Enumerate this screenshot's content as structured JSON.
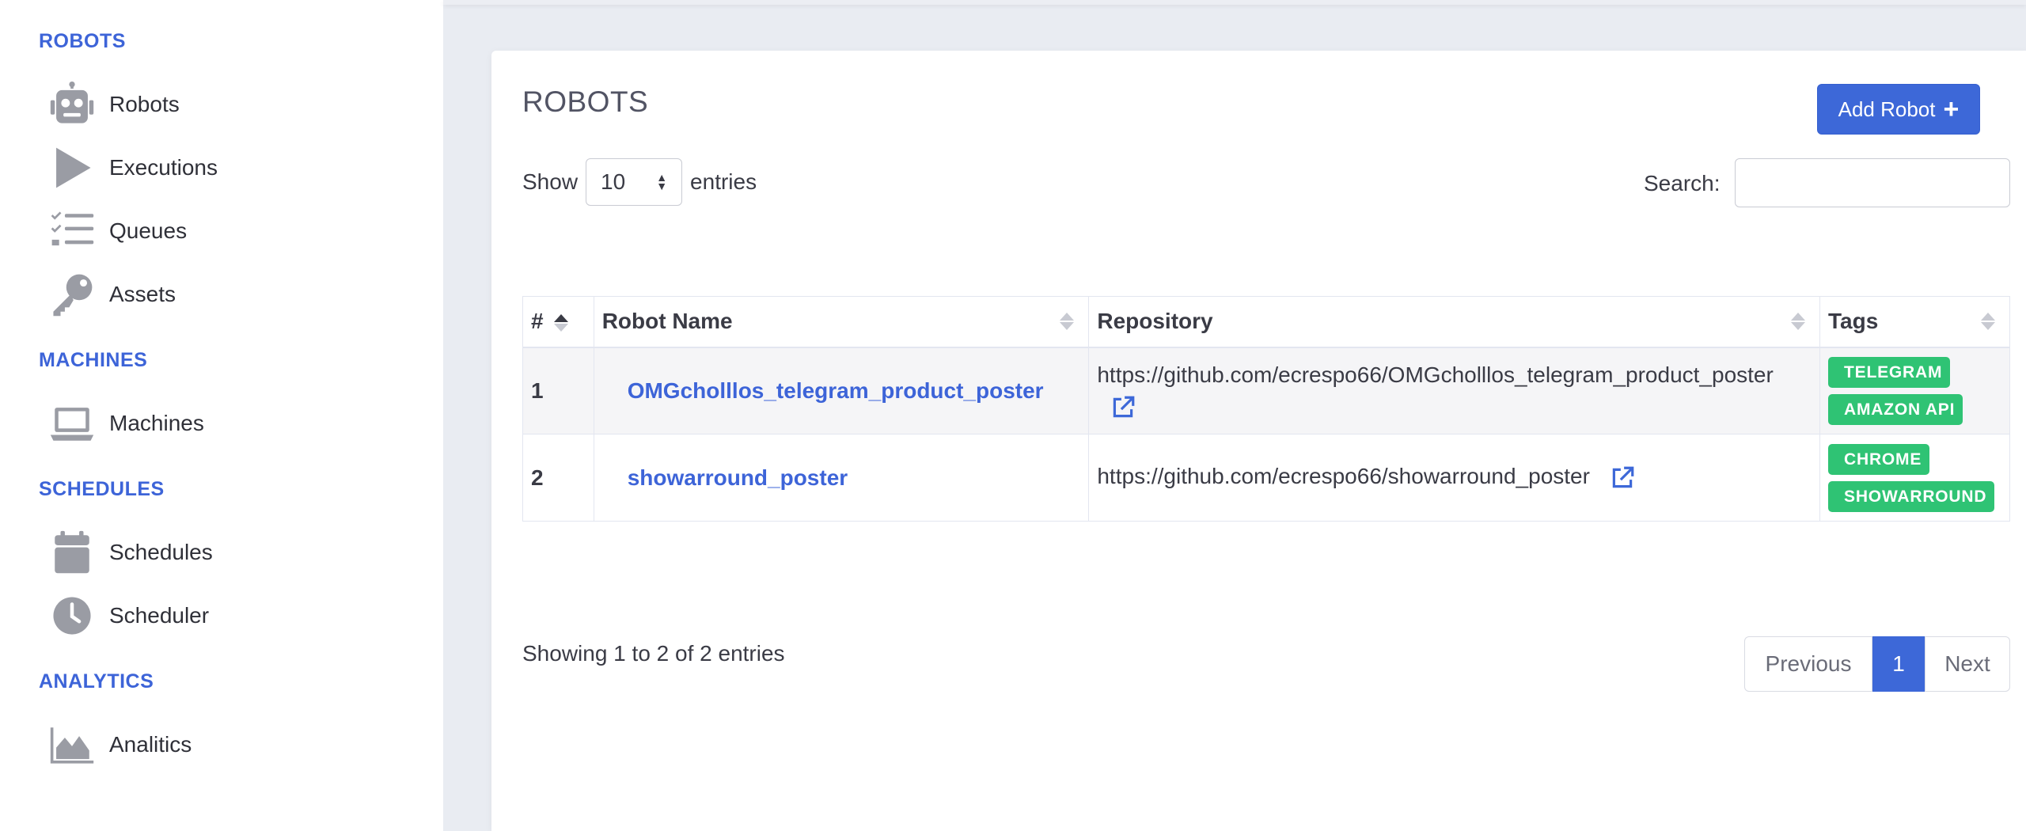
{
  "sidebar": {
    "sections": [
      {
        "heading": "ROBOTS",
        "items": [
          {
            "label": "Robots",
            "icon": "robot-icon"
          },
          {
            "label": "Executions",
            "icon": "play-icon"
          },
          {
            "label": "Queues",
            "icon": "list-check-icon"
          },
          {
            "label": "Assets",
            "icon": "key-icon"
          }
        ]
      },
      {
        "heading": "MACHINES",
        "items": [
          {
            "label": "Machines",
            "icon": "laptop-icon"
          }
        ]
      },
      {
        "heading": "SCHEDULES",
        "items": [
          {
            "label": "Schedules",
            "icon": "calendar-icon"
          },
          {
            "label": "Scheduler",
            "icon": "clock-icon"
          }
        ]
      },
      {
        "heading": "ANALYTICS",
        "items": [
          {
            "label": "Analitics",
            "icon": "area-chart-icon"
          }
        ]
      }
    ]
  },
  "page": {
    "title": "ROBOTS",
    "add_button_label": "Add Robot",
    "show_label": "Show",
    "entries_label": "entries",
    "page_length": "10",
    "search_label": "Search:",
    "search_value": ""
  },
  "table": {
    "columns": [
      "#",
      "Robot Name",
      "Repository",
      "Tags"
    ],
    "rows": [
      {
        "num": "1",
        "name": "OMGcholllos_telegram_product_poster",
        "repo": "https://github.com/ecrespo66/OMGcholllos_telegram_product_poster",
        "tags": [
          "TELEGRAM",
          "AMAZON API"
        ]
      },
      {
        "num": "2",
        "name": "showarround_poster",
        "repo": "https://github.com/ecrespo66/showarround_poster",
        "tags": [
          "CHROME",
          "SHOWARROUND"
        ]
      }
    ]
  },
  "footer": {
    "info": "Showing 1 to 2 of 2 entries",
    "prev": "Previous",
    "current": "1",
    "next": "Next"
  },
  "colors": {
    "accent": "#3d68d8",
    "tag": "#2fc374",
    "sidebar_icon": "#9a9ca4"
  }
}
